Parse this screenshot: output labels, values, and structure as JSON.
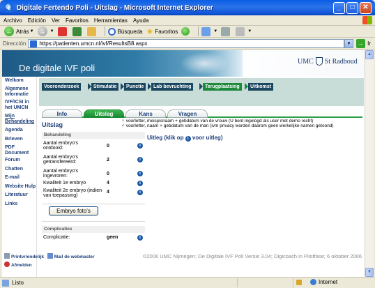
{
  "window": {
    "title": "Digitale Fertendo Poli - Uitslag - Microsoft Internet Explorer"
  },
  "menu": [
    "Archivo",
    "Edición",
    "Ver",
    "Favoritos",
    "Herramientas",
    "Ayuda"
  ],
  "toolbar": {
    "back_label": "Atrás",
    "search_label": "Búsqueda",
    "favorites_label": "Favoritos"
  },
  "address": {
    "label": "Dirección",
    "url": "https://patienten.umcn.nl/ivf/ResultsB8.aspx",
    "go_label": "Ir"
  },
  "banner": {
    "title": "De digitale IVF poli",
    "logo_left": "UMC",
    "logo_right": "St Radboud"
  },
  "sidebar": [
    {
      "label": "Welkom"
    },
    {
      "label": "Algemene Informatie"
    },
    {
      "label": "IVF/ICSI in het UMCN"
    },
    {
      "label": "Mijn Behandeling"
    },
    {
      "label": "Agenda"
    },
    {
      "label": "Brieven"
    },
    {
      "label": "PDF Document"
    },
    {
      "label": "Forum"
    },
    {
      "label": "Chatten"
    },
    {
      "label": "E-mail"
    },
    {
      "label": "Website Hulp"
    },
    {
      "label": "Literatuur"
    },
    {
      "label": "Links"
    }
  ],
  "flow_steps": [
    "Vooronderzoek",
    "Stimulatie",
    "Punctie",
    "Lab bevruchting",
    "Terugplaatsing",
    "Uitkomst"
  ],
  "tabs": [
    "Info",
    "Uitslag",
    "Kans",
    "Vragen"
  ],
  "section_title": "Uitslag",
  "legend": {
    "line1": "voorletter, meisjesnaam + gebdatum van de vrouw (U bent ingelogd als user met demo recht)",
    "line2": "voorletter, naam + gebdatum van de man (ivm privacy worden daarom geen werkelijke namen getoond)"
  },
  "treatment": {
    "header": "Behandeling",
    "rows": [
      {
        "label": "Aantal embryo's ontdooid:",
        "value": "0"
      },
      {
        "label": "Aantal embryo's getransfereerd:",
        "value": "2"
      },
      {
        "label": "Aantal embryo's ingevroren:",
        "value": "0"
      },
      {
        "label": "Kwaliteit 1e embryo",
        "value": "4"
      },
      {
        "label": "Kwaliteit 2e embryo (indien van toepassing)",
        "value": "4"
      }
    ]
  },
  "photo_button": "Embryo foto's",
  "complications": {
    "header": "Complicaties",
    "label": "Complicatie:",
    "value": "geen"
  },
  "uitleg": {
    "prefix": "Uitleg (klik op",
    "suffix": "voor uitleg)"
  },
  "footer": {
    "print": "Printvriendelijk",
    "mail": "Mail de webmaster",
    "logout": "Afmelden",
    "copyright": "©2006 UMC Nijmegen; De Digitale IVF Poli Versie 3.04; Digicoach in Pilotfase; 6 oktober 2006"
  },
  "status": {
    "text": "Listo",
    "zone": "Internet"
  },
  "colors": {
    "accent_green": "#1c8a3a",
    "nav_blue": "#1d3f7a",
    "flow_bg": "#c9ddd8"
  }
}
